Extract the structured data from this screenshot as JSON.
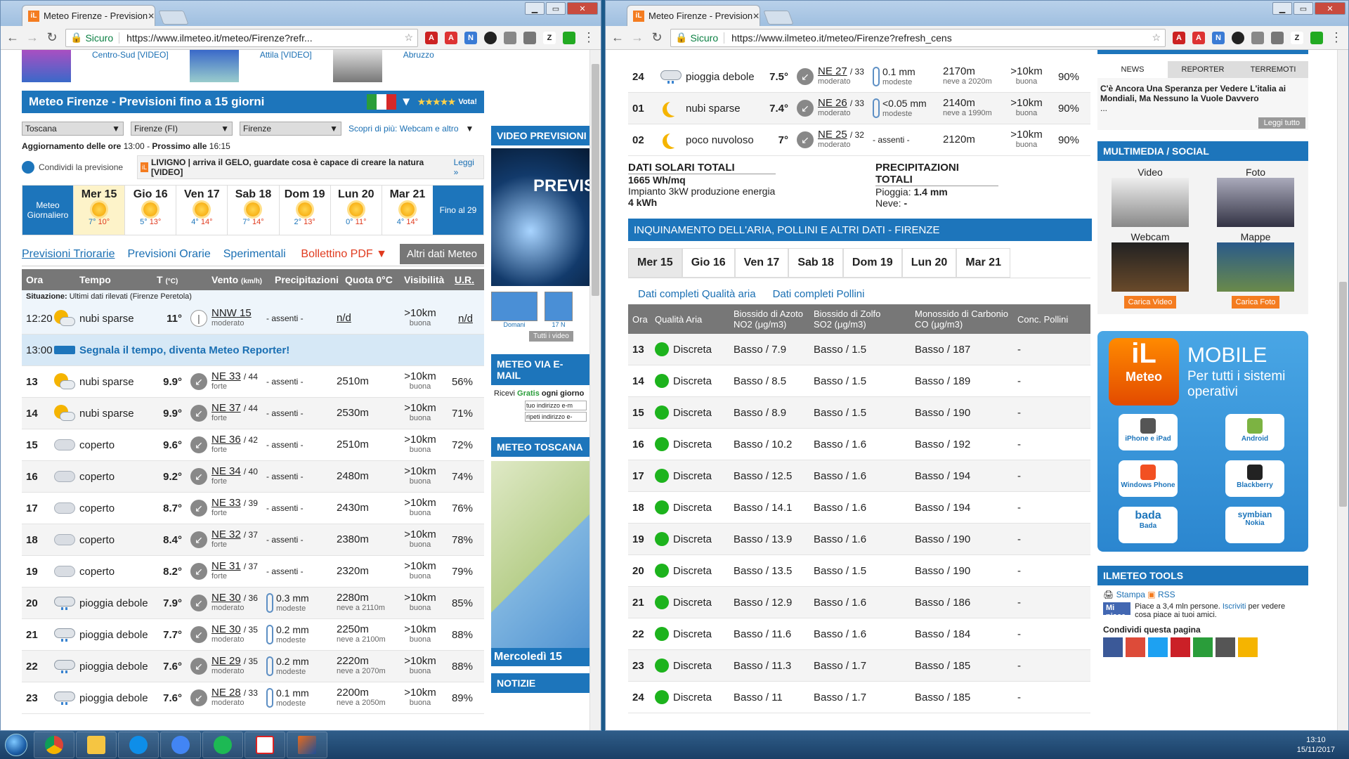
{
  "left": {
    "tab_title": "Meteo Firenze - Prevision",
    "url": "https://www.ilmeteo.it/meteo/Firenze?refr...",
    "sicuro": "Sicuro",
    "top_links": [
      "Centro-Sud [VIDEO]",
      "Attila [VIDEO]",
      "Abruzzo"
    ],
    "page_title": "Meteo Firenze - Previsioni fino a 15 giorni",
    "vota": "Vota!",
    "selects": [
      "Toscana",
      "Firenze (FI)",
      "Firenze"
    ],
    "scopri": "Scopri di più: Webcam e altro",
    "aggiornamento": "Aggiornamento delle ore",
    "agg_time": "13:00",
    "prossimo": "Prossimo alle",
    "prossimo_time": "16:15",
    "condividi": "Condividi la previsione",
    "banner": "LIVIGNO | arriva il GELO, guardate cosa è capace di creare la natura [VIDEO]",
    "banner_link": "Leggi »",
    "meteo_giornaliero": "Meteo Giornaliero",
    "fino": "Fino al 29",
    "days": [
      {
        "name": "Mer 15",
        "min": "7°",
        "max": "10°"
      },
      {
        "name": "Gio 16",
        "min": "5°",
        "max": "13°"
      },
      {
        "name": "Ven 17",
        "min": "4°",
        "max": "14°"
      },
      {
        "name": "Sab 18",
        "min": "7°",
        "max": "14°"
      },
      {
        "name": "Dom 19",
        "min": "2°",
        "max": "13°"
      },
      {
        "name": "Lun 20",
        "min": "0°",
        "max": "11°"
      },
      {
        "name": "Mar 21",
        "min": "4°",
        "max": "14°"
      }
    ],
    "subtabs": [
      "Previsioni Triorarie",
      "Previsioni Orarie",
      "Sperimentali"
    ],
    "bollettino": "Bollettino PDF",
    "altri": "Altri dati Meteo",
    "cols": [
      "Ora",
      "Tempo",
      "T",
      "(°C)",
      "Vento",
      "(km/h)",
      "Precipitazioni",
      "Quota 0°C",
      "Visibilità",
      "U.R."
    ],
    "situazione_label": "Situazione:",
    "situazione_text": "Ultimi dati rilevati (Firenze Peretola)",
    "now": {
      "ora": "12:20",
      "tempo": "nubi sparse",
      "t": "11°",
      "v": "NNW",
      "vs": "15",
      "vd": "moderato",
      "p": "- assenti -",
      "q": "n/d",
      "vis": ">10km",
      "visd": "buona",
      "ur": "n/d"
    },
    "reporter_ora": "13:00",
    "reporter": "Segnala il tempo, diventa Meteo Reporter!",
    "rows": [
      {
        "ora": "13",
        "icon": "suncloud",
        "tempo": "nubi sparse",
        "t": "9.9°",
        "v": "NE 33",
        "r": "/ 44",
        "vd": "forte",
        "p": "- assenti -",
        "pd": "",
        "q": "2510m",
        "qd": "",
        "ur": "56%"
      },
      {
        "ora": "14",
        "icon": "suncloud",
        "tempo": "nubi sparse",
        "t": "9.9°",
        "v": "NE 37",
        "r": "/ 44",
        "vd": "forte",
        "p": "- assenti -",
        "pd": "",
        "q": "2530m",
        "qd": "",
        "ur": "71%"
      },
      {
        "ora": "15",
        "icon": "cloud",
        "tempo": "coperto",
        "t": "9.6°",
        "v": "NE 36",
        "r": "/ 42",
        "vd": "forte",
        "p": "- assenti -",
        "pd": "",
        "q": "2510m",
        "qd": "",
        "ur": "72%"
      },
      {
        "ora": "16",
        "icon": "cloud",
        "tempo": "coperto",
        "t": "9.2°",
        "v": "NE 34",
        "r": "/ 40",
        "vd": "forte",
        "p": "- assenti -",
        "pd": "",
        "q": "2480m",
        "qd": "",
        "ur": "74%"
      },
      {
        "ora": "17",
        "icon": "cloud",
        "tempo": "coperto",
        "t": "8.7°",
        "v": "NE 33",
        "r": "/ 39",
        "vd": "forte",
        "p": "- assenti -",
        "pd": "",
        "q": "2430m",
        "qd": "",
        "ur": "76%"
      },
      {
        "ora": "18",
        "icon": "cloud",
        "tempo": "coperto",
        "t": "8.4°",
        "v": "NE 32",
        "r": "/ 37",
        "vd": "forte",
        "p": "- assenti -",
        "pd": "",
        "q": "2380m",
        "qd": "",
        "ur": "78%"
      },
      {
        "ora": "19",
        "icon": "cloud",
        "tempo": "coperto",
        "t": "8.2°",
        "v": "NE 31",
        "r": "/ 37",
        "vd": "forte",
        "p": "- assenti -",
        "pd": "",
        "q": "2320m",
        "qd": "",
        "ur": "79%"
      },
      {
        "ora": "20",
        "icon": "rain",
        "tempo": "pioggia debole",
        "t": "7.9°",
        "v": "NE 30",
        "r": "/ 36",
        "vd": "moderato",
        "p": "0.3 mm",
        "pd": "modeste",
        "q": "2280m",
        "qd": "neve a 2110m",
        "ur": "85%"
      },
      {
        "ora": "21",
        "icon": "rain",
        "tempo": "pioggia debole",
        "t": "7.7°",
        "v": "NE 30",
        "r": "/ 35",
        "vd": "moderato",
        "p": "0.2 mm",
        "pd": "modeste",
        "q": "2250m",
        "qd": "neve a 2100m",
        "ur": "88%"
      },
      {
        "ora": "22",
        "icon": "rain",
        "tempo": "pioggia debole",
        "t": "7.6°",
        "v": "NE 29",
        "r": "/ 35",
        "vd": "moderato",
        "p": "0.2 mm",
        "pd": "modeste",
        "q": "2220m",
        "qd": "neve a 2070m",
        "ur": "88%"
      },
      {
        "ora": "23",
        "icon": "rain",
        "tempo": "pioggia debole",
        "t": "7.6°",
        "v": "NE 28",
        "r": "/ 33",
        "vd": "moderato",
        "p": "0.1 mm",
        "pd": "modeste",
        "q": "2200m",
        "qd": "neve a 2050m",
        "ur": "89%"
      }
    ],
    "vis": ">10km",
    "visd": "buona",
    "side": {
      "video": "VIDEO PREVISIONI M",
      "previs": "PREVIS",
      "domani": "Domani",
      "n17": "17 N",
      "tutti": "Tutti i video",
      "email": "METEO VIA E-MAIL",
      "ricevi": "Ricevi",
      "gratis": "Gratis",
      "ogni": "ogni giorno",
      "tuo": "tuo indirizzo e-m",
      "ripeti": "ripeti indirizzo e-",
      "toscana": "METEO TOSCANA",
      "mercoledi": "Mercoledì 15",
      "notizie": "NOTIZIE"
    }
  },
  "right": {
    "tab_title": "Meteo Firenze - Prevision",
    "url": "https://www.ilmeteo.it/meteo/Firenze?refresh_cens",
    "sicuro": "Sicuro",
    "rows": [
      {
        "ora": "24",
        "icon": "rain",
        "tempo": "pioggia debole",
        "t": "7.5°",
        "v": "NE 27",
        "r": "/ 33",
        "vd": "moderato",
        "p": "0.1 mm",
        "pd": "modeste",
        "q": "2170m",
        "qd": "neve a 2020m",
        "ur": "90%"
      },
      {
        "ora": "01",
        "icon": "moon",
        "tempo": "nubi sparse",
        "t": "7.4°",
        "v": "NE 26",
        "r": "/ 33",
        "vd": "moderato",
        "p": "<0.05 mm",
        "pd": "modeste",
        "q": "2140m",
        "qd": "neve a 1990m",
        "ur": "90%"
      },
      {
        "ora": "02",
        "icon": "moon",
        "tempo": "poco nuvoloso",
        "t": "7°",
        "v": "NE 25",
        "r": "/ 32",
        "vd": "moderato",
        "p": "- assenti -",
        "pd": "",
        "q": "2120m",
        "qd": "",
        "ur": "90%"
      }
    ],
    "vis": ">10km",
    "visd": "buona",
    "solari_title": "DATI SOLARI TOTALI",
    "solari_val": "1665 Wh/mq",
    "impianto": "Impianto 3kW produzione energia",
    "kwh": "4 kWh",
    "precip_title": "PRECIPITAZIONI TOTALI",
    "pioggia_label": "Pioggia:",
    "pioggia": "1.4 mm",
    "neve_label": "Neve:",
    "neve": "-",
    "inq_title": "INQUINAMENTO DELL'ARIA, POLLINI E ALTRI DATI - FIRENZE",
    "days": [
      "Mer 15",
      "Gio 16",
      "Ven 17",
      "Sab 18",
      "Dom 19",
      "Lun 20",
      "Mar 21"
    ],
    "link_aria": "Dati completi Qualità aria",
    "link_pollini": "Dati completi Pollini",
    "aq_cols": {
      "ora": "Ora",
      "q": "Qualità Aria",
      "no2": "Biossido di Azoto",
      "no2u": "NO2 (μg/m3)",
      "so2": "Biossido di Zolfo",
      "so2u": "SO2 (μg/m3)",
      "co": "Monossido di Carbonio",
      "cou": "CO (μg/m3)",
      "poll": "Conc. Pollini"
    },
    "aq": [
      {
        "ora": "13",
        "q": "Discreta",
        "no2": "Basso / 7.9",
        "so2": "Basso / 1.5",
        "co": "Basso / 187",
        "p": "-"
      },
      {
        "ora": "14",
        "q": "Discreta",
        "no2": "Basso / 8.5",
        "so2": "Basso / 1.5",
        "co": "Basso / 189",
        "p": "-"
      },
      {
        "ora": "15",
        "q": "Discreta",
        "no2": "Basso / 8.9",
        "so2": "Basso / 1.5",
        "co": "Basso / 190",
        "p": "-"
      },
      {
        "ora": "16",
        "q": "Discreta",
        "no2": "Basso / 10.2",
        "so2": "Basso / 1.6",
        "co": "Basso / 192",
        "p": "-"
      },
      {
        "ora": "17",
        "q": "Discreta",
        "no2": "Basso / 12.5",
        "so2": "Basso / 1.6",
        "co": "Basso / 194",
        "p": "-"
      },
      {
        "ora": "18",
        "q": "Discreta",
        "no2": "Basso / 14.1",
        "so2": "Basso / 1.6",
        "co": "Basso / 194",
        "p": "-"
      },
      {
        "ora": "19",
        "q": "Discreta",
        "no2": "Basso / 13.9",
        "so2": "Basso / 1.6",
        "co": "Basso / 190",
        "p": "-"
      },
      {
        "ora": "20",
        "q": "Discreta",
        "no2": "Basso / 13.5",
        "so2": "Basso / 1.5",
        "co": "Basso / 190",
        "p": "-"
      },
      {
        "ora": "21",
        "q": "Discreta",
        "no2": "Basso / 12.9",
        "so2": "Basso / 1.6",
        "co": "Basso / 186",
        "p": "-"
      },
      {
        "ora": "22",
        "q": "Discreta",
        "no2": "Basso / 11.6",
        "so2": "Basso / 1.6",
        "co": "Basso / 184",
        "p": "-"
      },
      {
        "ora": "23",
        "q": "Discreta",
        "no2": "Basso / 11.3",
        "so2": "Basso / 1.7",
        "co": "Basso / 185",
        "p": "-"
      },
      {
        "ora": "24",
        "q": "Discreta",
        "no2": "Basso / 11",
        "so2": "Basso / 1.7",
        "co": "Basso / 185",
        "p": "-"
      }
    ],
    "side": {
      "news_tabs": [
        "NEWS",
        "REPORTER",
        "TERREMOTI"
      ],
      "news_text": "C'è Ancora Una Speranza per Vedere L'italia ai Mondiali, Ma Nessuno la Vuole Davvero",
      "news_more": "...",
      "leggi_tutto": "Leggi tutto",
      "multimedia": "MULTIMEDIA / SOCIAL",
      "mm": [
        "Video",
        "Foto",
        "Webcam",
        "Mappe"
      ],
      "carica_video": "Carica Video",
      "carica_foto": "Carica Foto",
      "mobile": "MOBILE",
      "per_tutti": "Per tutti i sistemi operativi",
      "il": "iL",
      "meteo": "Meteo",
      "apps": [
        "iPhone e iPad",
        "Android",
        "Windows Phone",
        "Blackberry",
        "Bada",
        "Nokia"
      ],
      "bada": "bada",
      "symbian": "symbian",
      "tools": "ILMETEO TOOLS",
      "stampa": "Stampa",
      "rss": "RSS",
      "mipiace": "Mi piace",
      "piace_text": "Piace a 3,4 mln persone.",
      "iscriviti": "Iscriviti",
      "piace_text2": "per vedere cosa piace ai tuoi amici.",
      "condividi": "Condividi questa pagina"
    }
  },
  "taskbar": {
    "time": "13:10",
    "date": "15/11/2017"
  },
  "colors": {
    "brand_blue": "#1d75bb",
    "green": "#1db31d",
    "accent_red": "#e03a1e"
  }
}
